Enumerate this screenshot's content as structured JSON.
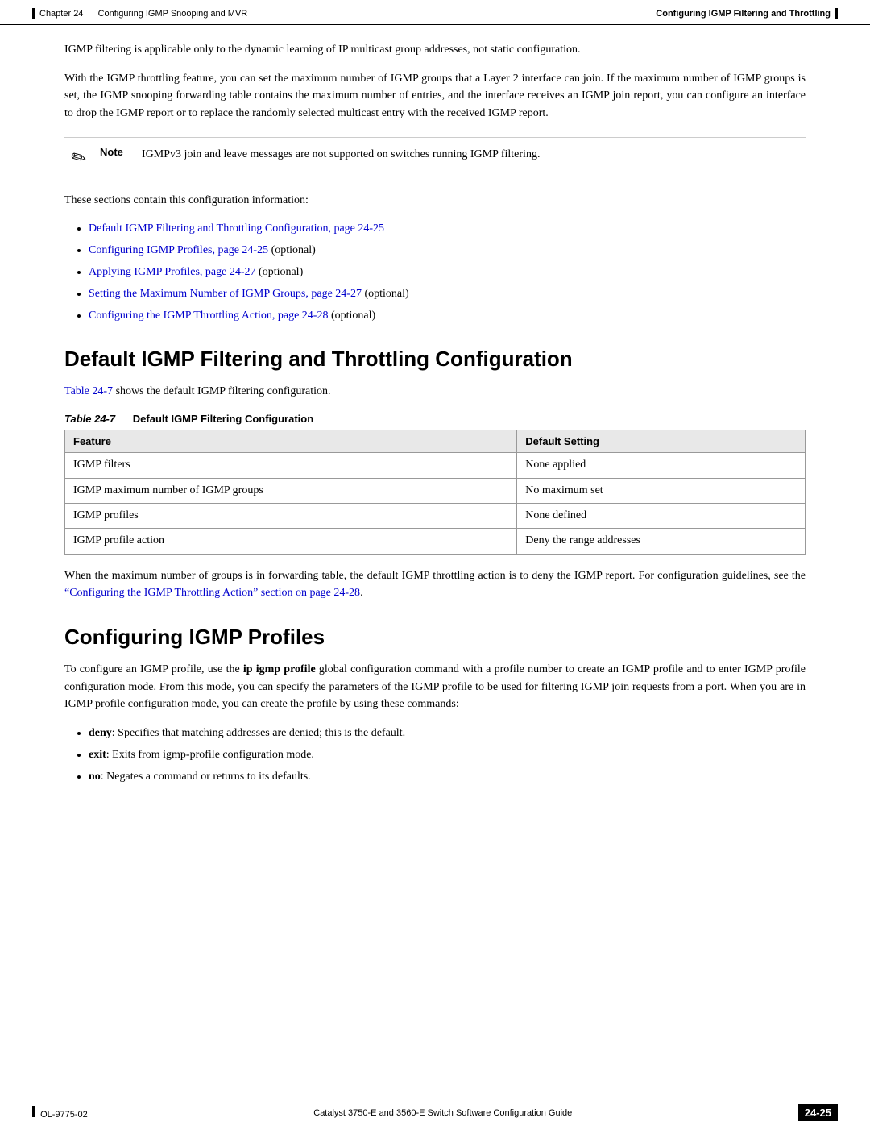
{
  "header": {
    "left_bar": true,
    "chapter": "Chapter 24",
    "chapter_title": "Configuring IGMP Snooping and MVR",
    "right_title": "Configuring IGMP Filtering and Throttling",
    "right_bar": true
  },
  "footer": {
    "left_bar": true,
    "left_text": "OL-9775-02",
    "center_text": "Catalyst 3750-E and 3560-E Switch Software Configuration Guide",
    "page": "24-25"
  },
  "content": {
    "para1": "IGMP filtering is applicable only to the dynamic learning of IP multicast group addresses, not static configuration.",
    "para2": "With the IGMP throttling feature, you can set the maximum number of IGMP groups that a Layer 2 interface can join. If the maximum number of IGMP groups is set, the IGMP snooping forwarding table contains the maximum number of entries, and the interface receives an IGMP join report, you can configure an interface to drop the IGMP report or to replace the randomly selected multicast entry with the received IGMP report.",
    "note_text": "IGMPv3 join and leave messages are not supported on switches running IGMP filtering.",
    "sections_intro": "These sections contain this configuration information:",
    "links": [
      {
        "text": "Default IGMP Filtering and Throttling Configuration, page 24-25",
        "suffix": ""
      },
      {
        "text": "Configuring IGMP Profiles, page 24-25",
        "suffix": " (optional)"
      },
      {
        "text": "Applying IGMP Profiles, page 24-27",
        "suffix": " (optional)"
      },
      {
        "text": "Setting the Maximum Number of IGMP Groups, page 24-27",
        "suffix": " (optional)"
      },
      {
        "text": "Configuring the IGMP Throttling Action, page 24-28",
        "suffix": " (optional)"
      }
    ],
    "section1_heading": "Default IGMP Filtering and Throttling Configuration",
    "table_intro": " shows the default IGMP filtering configuration.",
    "table_ref": "Table 24-7",
    "table_caption_label": "Table 24-7",
    "table_caption_title": "Default IGMP Filtering Configuration",
    "table_headers": [
      "Feature",
      "Default Setting"
    ],
    "table_rows": [
      [
        "IGMP filters",
        "None applied"
      ],
      [
        "IGMP maximum number of IGMP groups",
        "No maximum set"
      ],
      [
        "IGMP profiles",
        "None defined"
      ],
      [
        "IGMP profile action",
        "Deny the range addresses"
      ]
    ],
    "para_after_table1": "When the maximum number of groups is in forwarding table, the default IGMP throttling action is to deny the IGMP report. For configuration guidelines, see the ",
    "para_after_table_link": "“Configuring the IGMP Throttling Action” section on page 24-28",
    "para_after_table2": ".",
    "section2_heading": "Configuring IGMP Profiles",
    "section2_para": "To configure an IGMP profile, use the ",
    "section2_cmd": "ip igmp profile",
    "section2_para2": " global configuration command with a profile number to create an IGMP profile and to enter IGMP profile configuration mode. From this mode, you can specify the parameters of the IGMP profile to be used for filtering IGMP join requests from a port. When you are in IGMP profile configuration mode, you can create the profile by using these commands:",
    "section2_bullets": [
      {
        "bold": "deny",
        "text": ": Specifies that matching addresses are denied; this is the default."
      },
      {
        "bold": "exit",
        "text": ": Exits from igmp-profile configuration mode."
      },
      {
        "bold": "no",
        "text": ": Negates a command or returns to its defaults."
      }
    ]
  }
}
